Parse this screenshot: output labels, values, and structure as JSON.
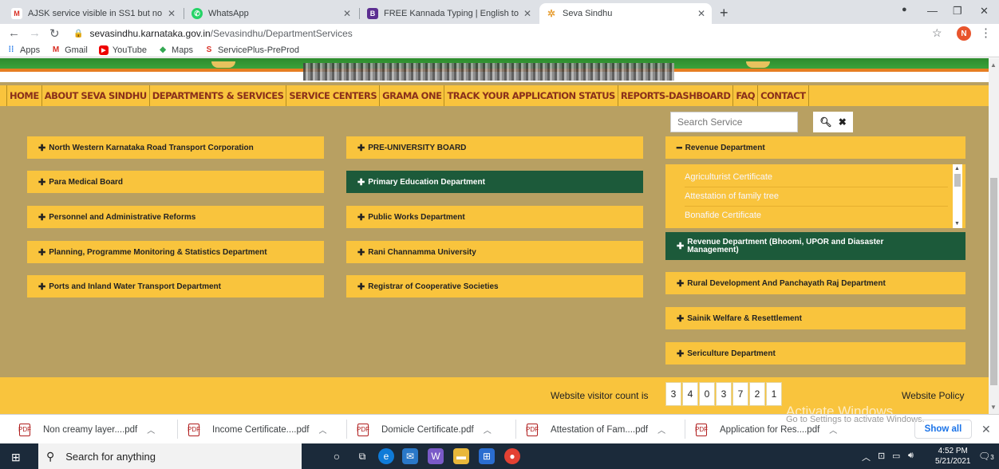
{
  "browser": {
    "tabs": [
      {
        "title": "AJSK service visible in SS1 but no",
        "icon": "gmail-icon",
        "color": "#d93025"
      },
      {
        "title": "WhatsApp",
        "icon": "whatsapp-icon",
        "color": "#25d366"
      },
      {
        "title": "FREE Kannada Typing | English to",
        "icon": "typing-icon",
        "color": "#5c2e91"
      },
      {
        "title": "Seva Sindhu",
        "icon": "seva-sindhu-icon",
        "color": "#e8a33d"
      }
    ],
    "url_host": "sevasindhu.karnataka.gov.in",
    "url_path": "/Sevasindhu/DepartmentServices",
    "profile_initial": "N",
    "bookmarks": [
      {
        "label": "Apps",
        "icon": "apps-grid-icon"
      },
      {
        "label": "Gmail",
        "icon": "gmail-icon"
      },
      {
        "label": "YouTube",
        "icon": "youtube-icon"
      },
      {
        "label": "Maps",
        "icon": "maps-icon"
      },
      {
        "label": "ServicePlus-PreProd",
        "icon": "serviceplus-icon"
      }
    ]
  },
  "site": {
    "menu": [
      "HOME",
      "ABOUT SEVA SINDHU",
      "DEPARTMENTS & SERVICES",
      "SERVICE CENTERS",
      "GRAMA ONE",
      "TRACK YOUR APPLICATION STATUS",
      "REPORTS-DASHBOARD",
      "FAQ",
      "CONTACT"
    ],
    "search_placeholder": "Search Service",
    "col1": [
      "North Western Karnataka Road Transport Corporation",
      "Para Medical Board",
      "Personnel and Administrative Reforms",
      "Planning, Programme Monitoring & Statistics Department",
      "Ports and Inland Water Transport Department"
    ],
    "col2": [
      "PRE-UNIVERSITY BOARD",
      "Primary Education Department",
      "Public Works Department",
      "Rani Channamma University",
      "Registrar of Cooperative Societies"
    ],
    "col3_open": "Revenue Department",
    "revenue_services": [
      "Agriculturist Certificate",
      "Attestation of family tree",
      "Bonafide Certificate"
    ],
    "col3": [
      "Revenue Department (Bhoomi, UPOR and Diasaster Management)",
      "Rural Development And Panchayath Raj Department",
      "Sainik Welfare & Resettlement",
      "Sericulture Department"
    ],
    "visitor_label": "Website visitor count is",
    "visitor_digits": [
      "3",
      "4",
      "0",
      "3",
      "7",
      "2",
      "1"
    ],
    "policy": "Website Policy",
    "activate_title": "Activate Windows",
    "activate_sub": "Go to Settings to activate Windows."
  },
  "downloads": {
    "items": [
      "Non creamy layer....pdf",
      "Income Certificate....pdf",
      "Domicle Certificate.pdf",
      "Attestation of Fam....pdf",
      "Application for Res....pdf"
    ],
    "show_all": "Show all"
  },
  "taskbar": {
    "search_placeholder": "Search for anything",
    "time": "4:52 PM",
    "date": "5/21/2021",
    "notifications": "3"
  }
}
